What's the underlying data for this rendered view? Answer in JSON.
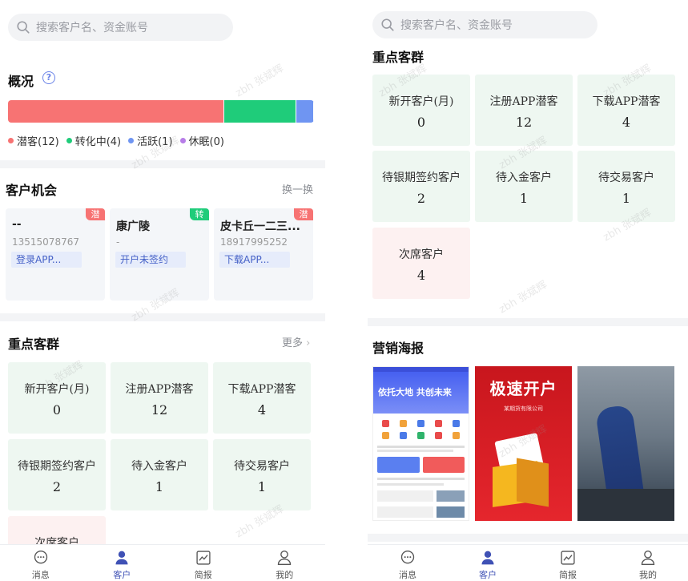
{
  "search": {
    "placeholder": "搜索客户名、资金账号"
  },
  "overview": {
    "title": "概况",
    "distribution": [
      {
        "label": "潜客(12)",
        "count": 12,
        "color": "#f77373"
      },
      {
        "label": "转化中(4)",
        "count": 4,
        "color": "#1fcc7a"
      },
      {
        "label": "活跃(1)",
        "count": 1,
        "color": "#6f95f2"
      },
      {
        "label": "休眠(0)",
        "count": 0,
        "color": "#b77de8"
      }
    ]
  },
  "opportunities": {
    "title": "客户机会",
    "refresh_label": "换一换",
    "cards": [
      {
        "name": "--",
        "phone": "13515078767",
        "status": "登录APP...",
        "tag": "潜",
        "tag_color": "#f77373"
      },
      {
        "name": "康广陵",
        "phone": "-",
        "status": "开户未签约",
        "tag": "转",
        "tag_color": "#1fcc7a"
      },
      {
        "name": "皮卡丘一二三...",
        "phone": "18917995252",
        "status": "下载APP...",
        "tag": "潜",
        "tag_color": "#f77373"
      }
    ]
  },
  "groups": {
    "title": "重点客群",
    "more_label": "更多",
    "partial_title": "重点客群",
    "tiles": [
      {
        "label": "新开客户(月)",
        "value": "0"
      },
      {
        "label": "注册APP潜客",
        "value": "12"
      },
      {
        "label": "下载APP潜客",
        "value": "4"
      },
      {
        "label": "待银期签约客户",
        "value": "2"
      },
      {
        "label": "待入金客户",
        "value": "1"
      },
      {
        "label": "待交易客户",
        "value": "1"
      },
      {
        "label": "次席客户",
        "value": "4"
      }
    ]
  },
  "marketing": {
    "title": "营销海报",
    "posters": [
      {
        "headline": "依托大地  共创未来"
      },
      {
        "headline": "极速开户",
        "sub": "某期货有限公司"
      },
      {
        "headline": ""
      }
    ]
  },
  "tabbar": {
    "items": [
      {
        "label": "消息",
        "icon": "message-icon"
      },
      {
        "label": "客户",
        "icon": "customer-icon"
      },
      {
        "label": "简报",
        "icon": "report-icon"
      },
      {
        "label": "我的",
        "icon": "profile-icon"
      }
    ]
  },
  "watermark": "zbh 张斌辉"
}
